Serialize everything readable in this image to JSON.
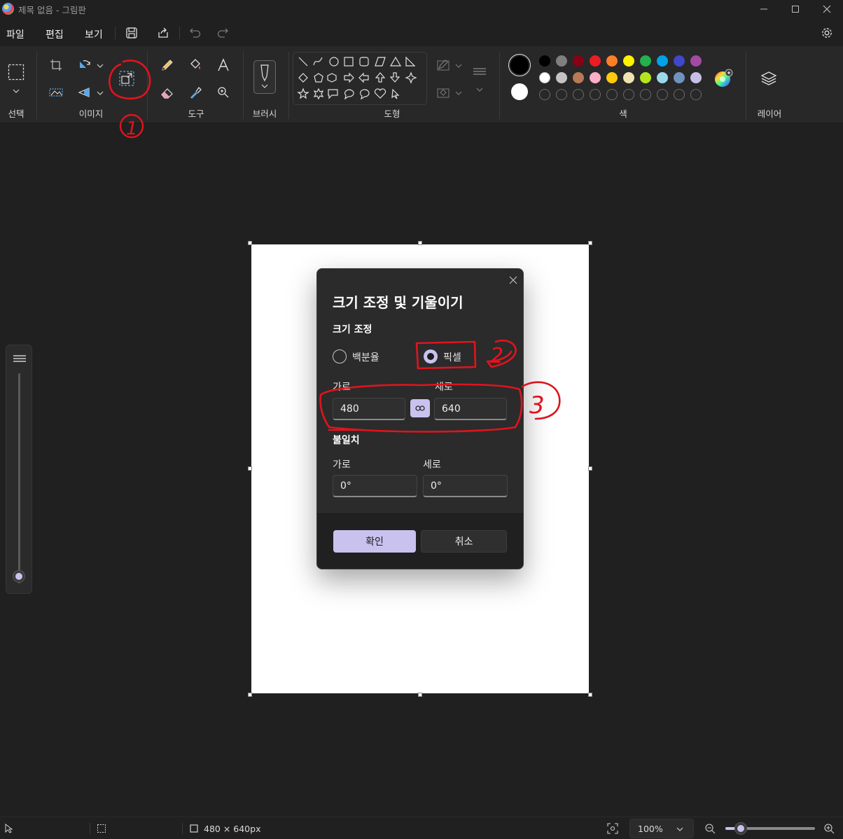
{
  "window": {
    "title": "제목 없음 - 그림판",
    "controls": [
      "minimize-icon",
      "maximize-icon",
      "close-icon"
    ]
  },
  "menu": {
    "items": [
      "파일",
      "편집",
      "보기"
    ],
    "quick_actions": [
      "save-icon",
      "share-icon",
      "undo-icon",
      "redo-icon"
    ],
    "settings_icon": "gear-icon"
  },
  "ribbon": {
    "groups": {
      "selection": "선택",
      "image": "이미지",
      "tools": "도구",
      "brush": "브러시",
      "shapes": "도형",
      "colors": "색",
      "layers": "레이어"
    },
    "palette_row1": [
      "#000000",
      "#7f7f7f",
      "#880015",
      "#ed1c24",
      "#ff7f27",
      "#fff200",
      "#22b14c",
      "#00a2e8",
      "#3f48cc",
      "#a349a4"
    ],
    "palette_row2": [
      "#ffffff",
      "#c3c3c3",
      "#b97a57",
      "#ffaec9",
      "#ffc90e",
      "#efe4b0",
      "#b5e61d",
      "#99d9ea",
      "#7092be",
      "#c8bfe7"
    ],
    "primary_color": "#000000",
    "secondary_color": "#ffffff"
  },
  "dialog": {
    "title": "크기 조정 및 기울이기",
    "resize_section": "크기 조정",
    "option_percent": "백분율",
    "option_pixel": "픽셀",
    "selected_option": "픽셀",
    "width_label": "가로",
    "height_label": "세로",
    "width_value": "480",
    "height_value": "640",
    "skew_section": "불일치",
    "skew_h_label": "가로",
    "skew_v_label": "세로",
    "skew_h_value": "0°",
    "skew_v_value": "0°",
    "ok_label": "확인",
    "cancel_label": "취소"
  },
  "status": {
    "canvas_size": "480 × 640px",
    "zoom": "100%",
    "zoom_slider_level": 0.17
  },
  "annotations": {
    "marks": [
      "1",
      "2",
      "3"
    ]
  }
}
